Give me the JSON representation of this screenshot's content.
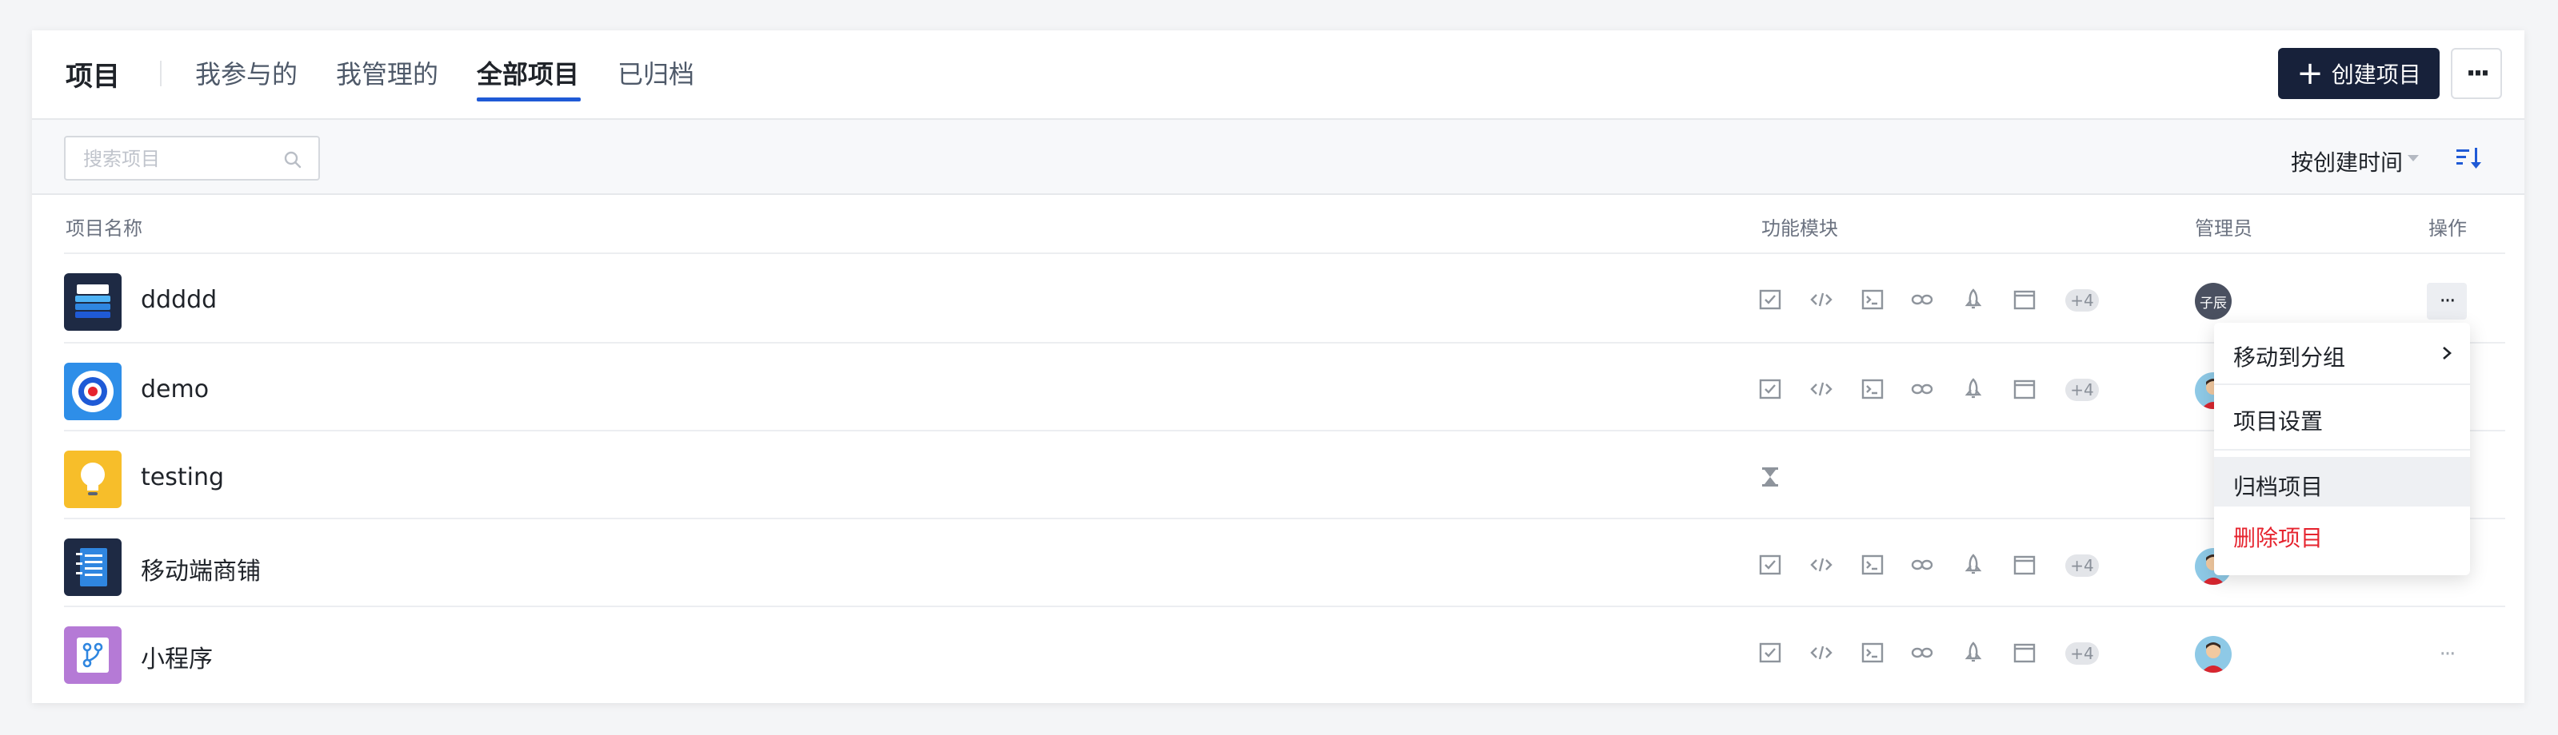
{
  "header": {
    "title": "项目",
    "tabs": [
      {
        "label": "我参与的",
        "active": false
      },
      {
        "label": "我管理的",
        "active": false
      },
      {
        "label": "全部项目",
        "active": true
      },
      {
        "label": "已归档",
        "active": false
      }
    ],
    "create_button": "创建项目",
    "more_button": "···"
  },
  "toolbar": {
    "search_placeholder": "搜索项目",
    "sort_label": "按创建时间"
  },
  "table": {
    "columns": {
      "name": "项目名称",
      "modules": "功能模块",
      "admin": "管理员",
      "actions": "操作"
    },
    "rows": [
      {
        "name": "ddddd",
        "icon": "database-icon",
        "modules": [
          "tasks",
          "code",
          "terminal",
          "links",
          "deploy",
          "window"
        ],
        "extra_modules": "+4",
        "admin_text": "子辰",
        "admin_type": "text"
      },
      {
        "name": "demo",
        "icon": "target-icon",
        "modules": [
          "tasks",
          "code",
          "terminal",
          "links",
          "deploy",
          "window"
        ],
        "extra_modules": "+4",
        "admin_type": "avatar"
      },
      {
        "name": "testing",
        "icon": "lightbulb-icon",
        "modules": [
          "hourglass"
        ],
        "extra_modules": "",
        "admin_type": "avatar"
      },
      {
        "name": "移动端商铺",
        "icon": "notebook-icon",
        "modules": [
          "tasks",
          "code",
          "terminal",
          "links",
          "deploy",
          "window"
        ],
        "extra_modules": "+4",
        "admin_type": "avatar"
      },
      {
        "name": "小程序",
        "icon": "branch-icon",
        "modules": [
          "tasks",
          "code",
          "terminal",
          "links",
          "deploy",
          "window"
        ],
        "extra_modules": "+4",
        "admin_type": "avatar"
      }
    ],
    "row_action": "···"
  },
  "menu": {
    "items": [
      {
        "label": "移动到分组",
        "submenu": true
      },
      {
        "label": "项目设置"
      },
      {
        "label": "归档项目",
        "hover": true
      },
      {
        "label": "删除项目",
        "danger": true
      }
    ]
  },
  "colors": {
    "accent": "#1f5ad6",
    "primary_button": "#17213a",
    "danger": "#e6242f"
  }
}
